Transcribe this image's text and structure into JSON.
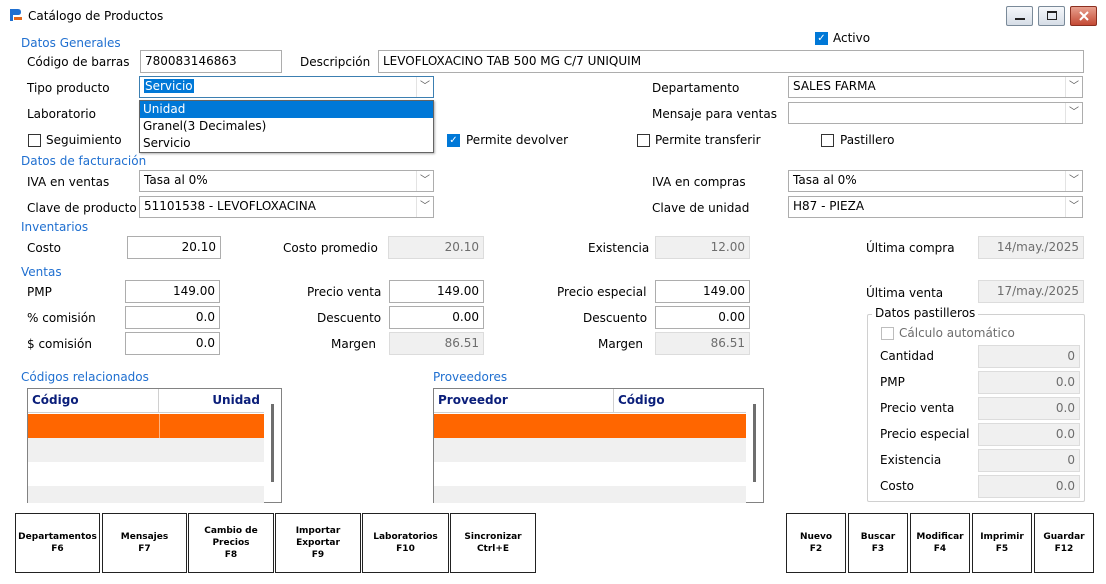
{
  "window": {
    "title": "Catálogo de Productos"
  },
  "sections": {
    "general": "Datos Generales",
    "billing": "Datos de facturación",
    "inventory": "Inventarios",
    "sales": "Ventas",
    "related_codes": "Códigos relacionados",
    "suppliers": "Proveedores",
    "pill_data": "Datos pastilleros"
  },
  "active": {
    "label": "Activo",
    "checked": true
  },
  "barcode": {
    "label": "Código de barras",
    "value": "780083146863"
  },
  "description": {
    "label": "Descripción",
    "value": "LEVOFLOXACINO TAB 500 MG C/7 UNIQUIM"
  },
  "product_type": {
    "label": "Tipo producto",
    "value": "Servicio",
    "options": [
      "Unidad",
      "Granel(3 Decimales)",
      "Servicio"
    ],
    "highlighted": "Unidad"
  },
  "department": {
    "label": "Departamento",
    "value": "SALES FARMA"
  },
  "laboratory": {
    "label": "Laboratorio",
    "value": ""
  },
  "sales_message": {
    "label": "Mensaje para ventas",
    "value": ""
  },
  "checks": {
    "tracking": {
      "label": "Seguimiento",
      "checked": false
    },
    "allow_return": {
      "label": "Permite devolver",
      "checked": true
    },
    "allow_transfer": {
      "label": "Permite transferir",
      "checked": false
    },
    "pillbox": {
      "label": "Pastillero",
      "checked": false
    }
  },
  "iva_sales": {
    "label": "IVA en ventas",
    "value": "Tasa al 0%"
  },
  "iva_purchases": {
    "label": "IVA en compras",
    "value": "Tasa al 0%"
  },
  "product_key": {
    "label": "Clave de producto",
    "value": "51101538 - LEVOFLOXACINA"
  },
  "unit_key": {
    "label": "Clave de unidad",
    "value": "H87 - PIEZA"
  },
  "inventory": {
    "cost": {
      "label": "Costo",
      "value": "20.10"
    },
    "avg_cost": {
      "label": "Costo promedio",
      "value": "20.10"
    },
    "stock": {
      "label": "Existencia",
      "value": "12.00"
    },
    "last_purchase": {
      "label": "Última compra",
      "value": "14/may./2025"
    }
  },
  "sales": {
    "pmp": {
      "label": "PMP",
      "value": "149.00"
    },
    "commission_pct": {
      "label": "% comisión",
      "value": "0.0"
    },
    "commission_amt": {
      "label": "$ comisión",
      "value": "0.0"
    },
    "sale_price": {
      "label": "Precio venta",
      "value": "149.00"
    },
    "discount1": {
      "label": "Descuento",
      "value": "0.00"
    },
    "margin1": {
      "label": "Margen",
      "value": "86.51"
    },
    "special_price": {
      "label": "Precio especial",
      "value": "149.00"
    },
    "discount2": {
      "label": "Descuento",
      "value": "0.00"
    },
    "margin2": {
      "label": "Margen",
      "value": "86.51"
    },
    "last_sale": {
      "label": "Última venta",
      "value": "17/may./2025"
    }
  },
  "pill": {
    "auto_calc": {
      "label": "Cálculo automático",
      "checked": false
    },
    "quantity": {
      "label": "Cantidad",
      "value": "0"
    },
    "pmp": {
      "label": "PMP",
      "value": "0.0"
    },
    "sale_price": {
      "label": "Precio venta",
      "value": "0.0"
    },
    "special_price": {
      "label": "Precio especial",
      "value": "0.0"
    },
    "stock": {
      "label": "Existencia",
      "value": "0"
    },
    "cost": {
      "label": "Costo",
      "value": "0.0"
    }
  },
  "related_grid": {
    "columns": [
      "Código",
      "Unidad"
    ]
  },
  "suppliers_grid": {
    "columns": [
      "Proveedor",
      "Código"
    ]
  },
  "buttons": {
    "departments": {
      "line1": "Departamentos",
      "line2": "F6"
    },
    "messages": {
      "line1": "Mensajes",
      "line2": "F7"
    },
    "price_change": {
      "line1": "Cambio de",
      "line2": "Precios",
      "line3": "F8"
    },
    "import_export": {
      "line1": "Importar",
      "line2": "Exportar",
      "line3": "F9"
    },
    "laboratories": {
      "line1": "Laboratorios",
      "line2": "F10"
    },
    "sync": {
      "line1": "Sincronizar",
      "line2": "Ctrl+E"
    },
    "new": {
      "line1": "Nuevo",
      "line2": "F2"
    },
    "search": {
      "line1": "Buscar",
      "line2": "F3"
    },
    "modify": {
      "line1": "Modificar",
      "line2": "F4"
    },
    "print": {
      "line1": "Imprimir",
      "line2": "F5"
    },
    "save": {
      "line1": "Guardar",
      "line2": "F12"
    }
  },
  "colors": {
    "accent": "#0078d7",
    "section": "#1f6fd0",
    "row_highlight": "#ff6600",
    "grid_header": "#0a1e7a"
  }
}
